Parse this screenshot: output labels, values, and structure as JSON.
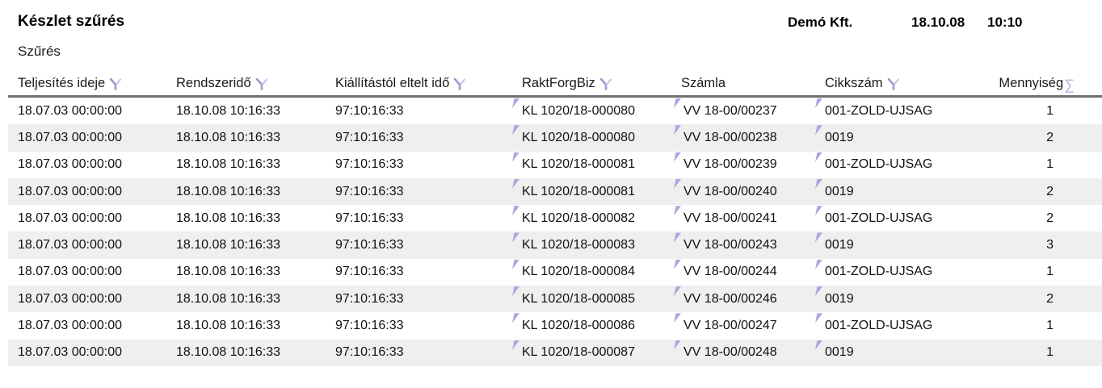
{
  "report": {
    "title": "Készlet szűrés",
    "subtitle": "Szűrés",
    "company": "Demó Kft.",
    "date": "18.10.08",
    "time": "10:10"
  },
  "table": {
    "columns": [
      {
        "label": "Teljesítés ideje",
        "icon": "filter"
      },
      {
        "label": "Rendszeridő",
        "icon": "filter"
      },
      {
        "label": "Kiállítástól eltelt idő",
        "icon": "filter"
      },
      {
        "label": "RaktForgBiz",
        "icon": "filter"
      },
      {
        "label": "Számla",
        "icon": "none"
      },
      {
        "label": "Cikkszám",
        "icon": "filter"
      },
      {
        "label": "Mennyiség",
        "icon": "sigma"
      }
    ],
    "rows": [
      {
        "teljesites": "18.07.03 00:00:00",
        "rendszerido": "18.10.08 10:16:33",
        "eltelt": "97:10:16:33",
        "raktforgbiz": "KL 1020/18-000080",
        "szamla": "VV 18-00/00237",
        "cikkszam": "001-ZOLD-UJSAG",
        "mennyiseg": "1"
      },
      {
        "teljesites": "18.07.03 00:00:00",
        "rendszerido": "18.10.08 10:16:33",
        "eltelt": "97:10:16:33",
        "raktforgbiz": "KL 1020/18-000080",
        "szamla": "VV 18-00/00238",
        "cikkszam": "0019",
        "mennyiseg": "2"
      },
      {
        "teljesites": "18.07.03 00:00:00",
        "rendszerido": "18.10.08 10:16:33",
        "eltelt": "97:10:16:33",
        "raktforgbiz": "KL 1020/18-000081",
        "szamla": "VV 18-00/00239",
        "cikkszam": "001-ZOLD-UJSAG",
        "mennyiseg": "1"
      },
      {
        "teljesites": "18.07.03 00:00:00",
        "rendszerido": "18.10.08 10:16:33",
        "eltelt": "97:10:16:33",
        "raktforgbiz": "KL 1020/18-000081",
        "szamla": "VV 18-00/00240",
        "cikkszam": "0019",
        "mennyiseg": "2"
      },
      {
        "teljesites": "18.07.03 00:00:00",
        "rendszerido": "18.10.08 10:16:33",
        "eltelt": "97:10:16:33",
        "raktforgbiz": "KL 1020/18-000082",
        "szamla": "VV 18-00/00241",
        "cikkszam": "001-ZOLD-UJSAG",
        "mennyiseg": "2"
      },
      {
        "teljesites": "18.07.03 00:00:00",
        "rendszerido": "18.10.08 10:16:33",
        "eltelt": "97:10:16:33",
        "raktforgbiz": "KL 1020/18-000083",
        "szamla": "VV 18-00/00243",
        "cikkszam": "0019",
        "mennyiseg": "3"
      },
      {
        "teljesites": "18.07.03 00:00:00",
        "rendszerido": "18.10.08 10:16:33",
        "eltelt": "97:10:16:33",
        "raktforgbiz": "KL 1020/18-000084",
        "szamla": "VV 18-00/00244",
        "cikkszam": "001-ZOLD-UJSAG",
        "mennyiseg": "1"
      },
      {
        "teljesites": "18.07.03 00:00:00",
        "rendszerido": "18.10.08 10:16:33",
        "eltelt": "97:10:16:33",
        "raktforgbiz": "KL 1020/18-000085",
        "szamla": "VV 18-00/00246",
        "cikkszam": "0019",
        "mennyiseg": "2"
      },
      {
        "teljesites": "18.07.03 00:00:00",
        "rendszerido": "18.10.08 10:16:33",
        "eltelt": "97:10:16:33",
        "raktforgbiz": "KL 1020/18-000086",
        "szamla": "VV 18-00/00247",
        "cikkszam": "001-ZOLD-UJSAG",
        "mennyiseg": "1"
      },
      {
        "teljesites": "18.07.03 00:00:00",
        "rendszerido": "18.10.08 10:16:33",
        "eltelt": "97:10:16:33",
        "raktforgbiz": "KL 1020/18-000087",
        "szamla": "VV 18-00/00248",
        "cikkszam": "0019",
        "mennyiseg": "1"
      }
    ]
  },
  "colors": {
    "accent_lavender": "#aca6dd",
    "row_stripe": "#efefef",
    "header_rule": "#6f6f6f",
    "text": "#111111"
  }
}
